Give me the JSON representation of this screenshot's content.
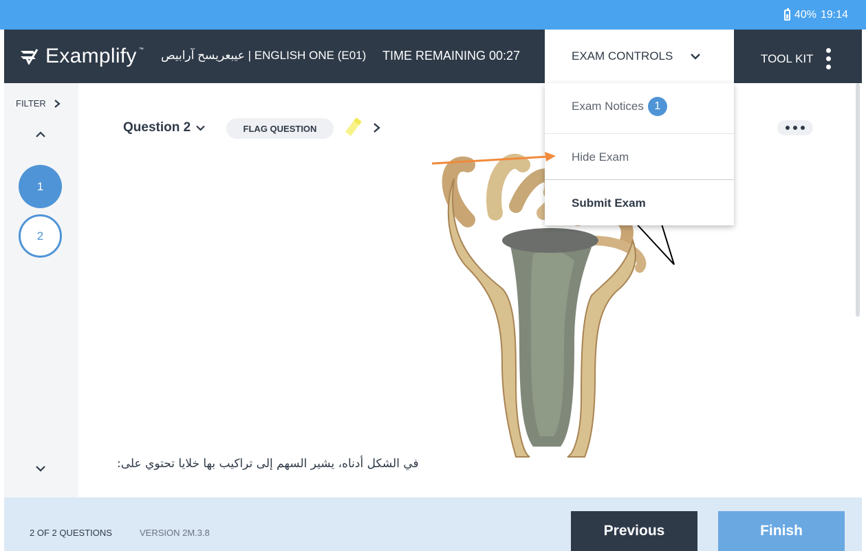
{
  "status_bar": {
    "battery": "40%",
    "time": "19:14"
  },
  "header": {
    "logo_text": "Examplify",
    "logo_tm": "™",
    "exam_title": "عيبعريسح آرابيص | ENGLISH ONE (E01)",
    "time_remaining": "TIME REMAINING 00:27",
    "exam_controls_label": "EXAM CONTROLS",
    "toolkit_label": "TOOL KIT"
  },
  "sidebar": {
    "filter_label": "FILTER",
    "questions": [
      "1",
      "2"
    ]
  },
  "question": {
    "selector_label": "Question 2",
    "flag_label": "FLAG QUESTION",
    "text": ":في الشكل أدناه، يشير السهم إلى تراكيب بها خلايا تحتوي على"
  },
  "menu": {
    "items": [
      {
        "label": "Exam Notices",
        "badge": "1"
      },
      {
        "label": "Hide Exam"
      },
      {
        "label": "Submit Exam"
      }
    ]
  },
  "footer": {
    "question_count": "2 OF 2 QUESTIONS",
    "version": "VERSION 2M.3.8",
    "previous_label": "Previous",
    "finish_label": "Finish"
  },
  "colors": {
    "header_bg": "#2e3a48",
    "status_bar_bg": "#4aa3ee",
    "accent": "#4f94d6",
    "footer_bg": "#dbe8f5",
    "arrow": "#f08a3c"
  }
}
